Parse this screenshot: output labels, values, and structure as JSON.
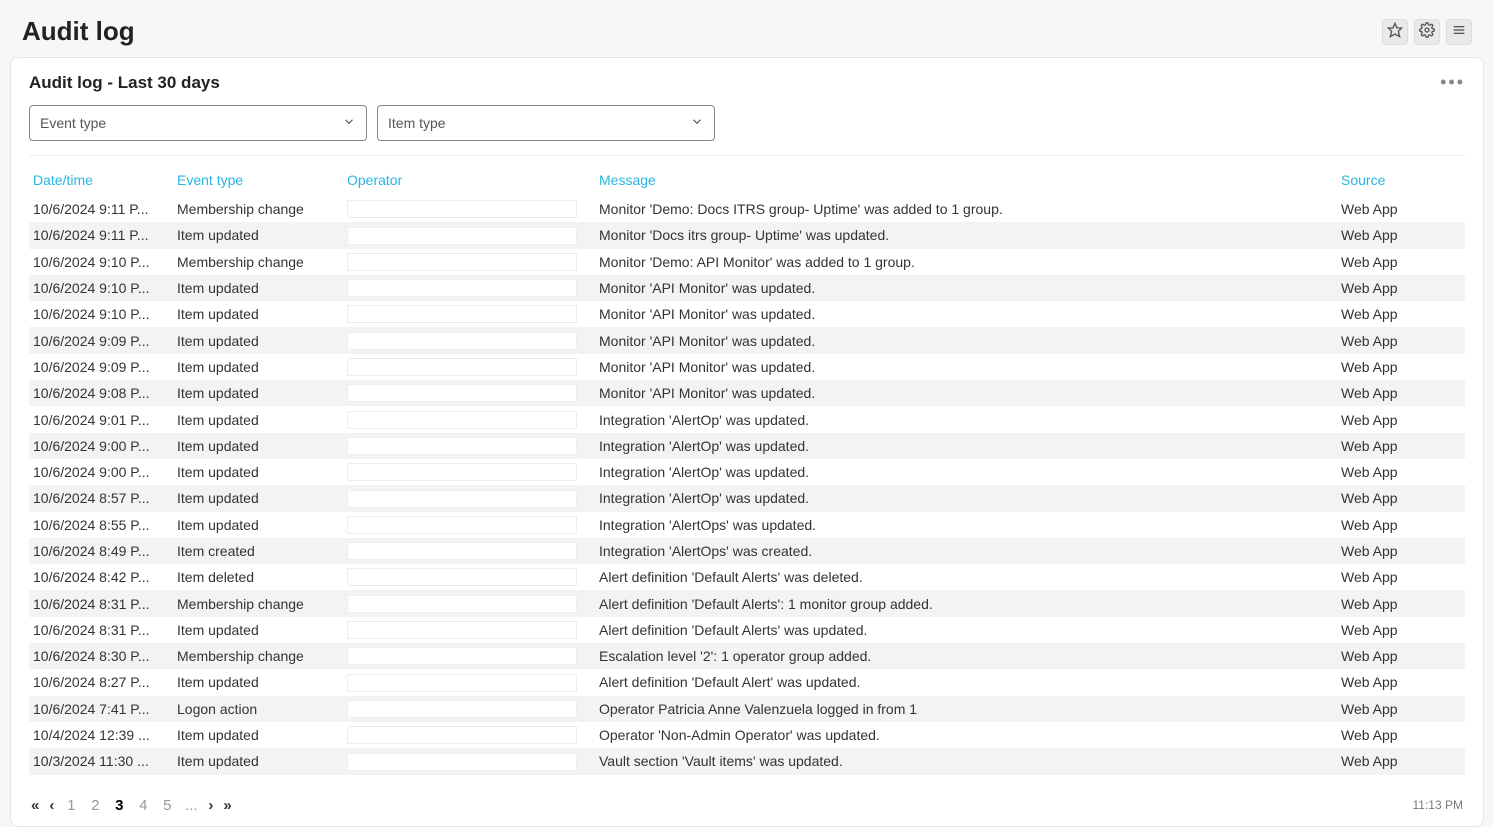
{
  "header": {
    "title": "Audit log"
  },
  "card": {
    "title": "Audit log - Last 30 days"
  },
  "filters": {
    "event_type_placeholder": "Event type",
    "item_type_placeholder": "Item type"
  },
  "columns": {
    "datetime": "Date/time",
    "event_type": "Event type",
    "operator": "Operator",
    "message": "Message",
    "source": "Source"
  },
  "rows": [
    {
      "dt": "10/6/2024 9:11 P...",
      "et": "Membership change",
      "msg": "Monitor 'Demo: Docs ITRS group- Uptime' was added to 1 group.",
      "src": "Web App"
    },
    {
      "dt": "10/6/2024 9:11 P...",
      "et": "Item updated",
      "msg": "Monitor 'Docs itrs group- Uptime' was updated.",
      "src": "Web App"
    },
    {
      "dt": "10/6/2024 9:10 P...",
      "et": "Membership change",
      "msg": "Monitor 'Demo: API Monitor' was added to 1 group.",
      "src": "Web App"
    },
    {
      "dt": "10/6/2024 9:10 P...",
      "et": "Item updated",
      "msg": "Monitor 'API Monitor' was updated.",
      "src": "Web App"
    },
    {
      "dt": "10/6/2024 9:10 P...",
      "et": "Item updated",
      "msg": "Monitor 'API Monitor' was updated.",
      "src": "Web App"
    },
    {
      "dt": "10/6/2024 9:09 P...",
      "et": "Item updated",
      "msg": "Monitor 'API Monitor' was updated.",
      "src": "Web App"
    },
    {
      "dt": "10/6/2024 9:09 P...",
      "et": "Item updated",
      "msg": "Monitor 'API Monitor' was updated.",
      "src": "Web App"
    },
    {
      "dt": "10/6/2024 9:08 P...",
      "et": "Item updated",
      "msg": "Monitor 'API Monitor' was updated.",
      "src": "Web App"
    },
    {
      "dt": "10/6/2024 9:01 P...",
      "et": "Item updated",
      "msg": "Integration 'AlertOp' was updated.",
      "src": "Web App"
    },
    {
      "dt": "10/6/2024 9:00 P...",
      "et": "Item updated",
      "msg": "Integration 'AlertOp' was updated.",
      "src": "Web App"
    },
    {
      "dt": "10/6/2024 9:00 P...",
      "et": "Item updated",
      "msg": "Integration 'AlertOp' was updated.",
      "src": "Web App"
    },
    {
      "dt": "10/6/2024 8:57 P...",
      "et": "Item updated",
      "msg": "Integration 'AlertOp' was updated.",
      "src": "Web App"
    },
    {
      "dt": "10/6/2024 8:55 P...",
      "et": "Item updated",
      "msg": "Integration 'AlertOps' was updated.",
      "src": "Web App"
    },
    {
      "dt": "10/6/2024 8:49 P...",
      "et": "Item created",
      "msg": "Integration 'AlertOps' was created.",
      "src": "Web App"
    },
    {
      "dt": "10/6/2024 8:42 P...",
      "et": "Item deleted",
      "msg": "Alert definition 'Default Alerts' was deleted.",
      "src": "Web App"
    },
    {
      "dt": "10/6/2024 8:31 P...",
      "et": "Membership change",
      "msg": "Alert definition 'Default Alerts': 1 monitor group added.",
      "src": "Web App"
    },
    {
      "dt": "10/6/2024 8:31 P...",
      "et": "Item updated",
      "msg": "Alert definition 'Default Alerts' was updated.",
      "src": "Web App"
    },
    {
      "dt": "10/6/2024 8:30 P...",
      "et": "Membership change",
      "msg": "Escalation level '2': 1 operator group added.",
      "src": "Web App"
    },
    {
      "dt": "10/6/2024 8:27 P...",
      "et": "Item updated",
      "msg": "Alert definition 'Default Alert' was updated.",
      "src": "Web App"
    },
    {
      "dt": "10/6/2024 7:41 P...",
      "et": "Logon action",
      "msg": "Operator Patricia Anne Valenzuela logged in from 1",
      "src": "Web App",
      "redact": true
    },
    {
      "dt": "10/4/2024 12:39 ...",
      "et": "Item updated",
      "msg": "Operator 'Non-Admin Operator' was updated.",
      "src": "Web App"
    },
    {
      "dt": "10/3/2024 11:30 ...",
      "et": "Item updated",
      "msg": "Vault section 'Vault items' was updated.",
      "src": "Web App"
    }
  ],
  "pagination": {
    "pages": [
      "1",
      "2",
      "3",
      "4",
      "5",
      "..."
    ],
    "current": "3"
  },
  "footer": {
    "time": "11:13 PM"
  }
}
